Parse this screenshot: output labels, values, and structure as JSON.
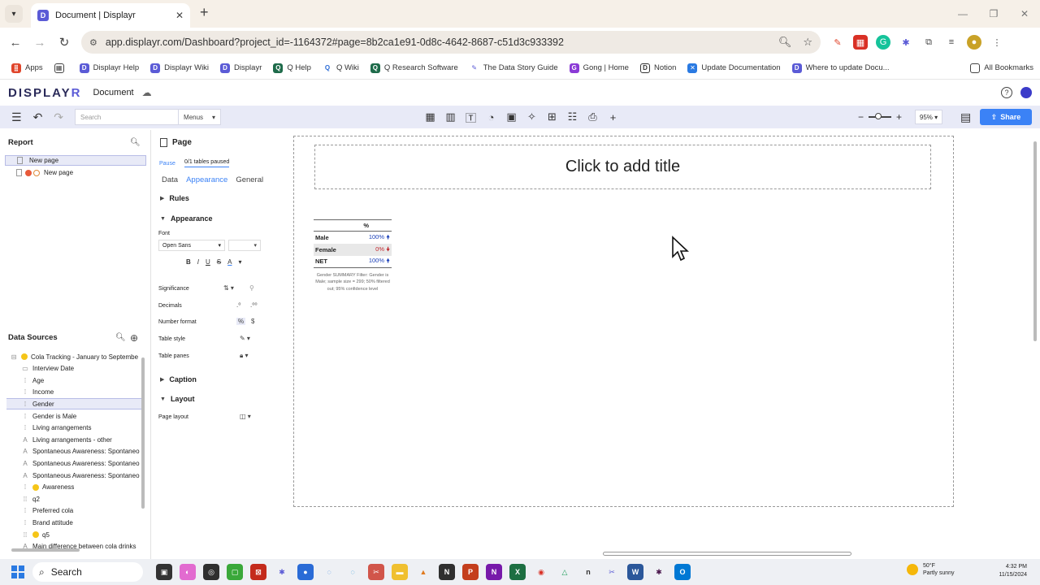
{
  "browser": {
    "tab_title": "Document | Displayr",
    "tab_favicon": "D",
    "url": "app.displayr.com/Dashboard?project_id=-1164372#page=8b2ca1e91-0d8c-4642-8687-c51d3c933392",
    "bookmarks": [
      "Apps",
      "Displayr Help",
      "Displayr Wiki",
      "Displayr",
      "Q Help",
      "Q Wiki",
      "Q Research Software",
      "The Data Story Guide",
      "Gong | Home",
      "Notion",
      "Update Documentation",
      "Where to update Docu..."
    ],
    "all_bookmarks": "All Bookmarks"
  },
  "app": {
    "logo_main": "DISPLAY",
    "logo_r": "R",
    "document_name": "Document",
    "search_placeholder": "Search",
    "menus_label": "Menus",
    "zoom": "95%",
    "share_label": "Share"
  },
  "report": {
    "heading": "Report",
    "pages": [
      "New page",
      "New page"
    ]
  },
  "data_sources": {
    "heading": "Data Sources",
    "items": [
      {
        "label": "Cola Tracking - January to Septembe",
        "icon": "dataset",
        "dot": true
      },
      {
        "label": "Interview Date",
        "icon": "date",
        "dot": false
      },
      {
        "label": "Age",
        "icon": "categorical",
        "dot": false
      },
      {
        "label": "Income",
        "icon": "categorical",
        "dot": false
      },
      {
        "label": "Gender",
        "icon": "categorical",
        "dot": false
      },
      {
        "label": "Gender is Male",
        "icon": "categorical",
        "dot": false
      },
      {
        "label": "Living arrangements",
        "icon": "categorical",
        "dot": false
      },
      {
        "label": "Living arrangements - other",
        "icon": "text",
        "dot": false
      },
      {
        "label": "Spontaneous Awareness: Spontaneo",
        "icon": "text",
        "dot": false
      },
      {
        "label": "Spontaneous Awareness: Spontaneo",
        "icon": "text",
        "dot": false
      },
      {
        "label": "Spontaneous Awareness: Spontaneo",
        "icon": "text",
        "dot": false
      },
      {
        "label": "Awareness",
        "icon": "categorical",
        "dot": true
      },
      {
        "label": "q2",
        "icon": "grid",
        "dot": false
      },
      {
        "label": "Preferred cola",
        "icon": "categorical",
        "dot": false
      },
      {
        "label": "Brand attitude",
        "icon": "categorical",
        "dot": false
      },
      {
        "label": "q5",
        "icon": "grid",
        "dot": true
      },
      {
        "label": "Main difference between cola drinks",
        "icon": "text",
        "dot": false
      }
    ]
  },
  "properties": {
    "title": "Page",
    "pause": "Pause",
    "paused_status": "0/1 tables paused",
    "tabs": [
      "Data",
      "Appearance",
      "General"
    ],
    "sections": {
      "rules": "Rules",
      "appearance": "Appearance",
      "caption": "Caption",
      "layout": "Layout"
    },
    "font_label": "Font",
    "font_value": "Open Sans",
    "rows": [
      "Significance",
      "Decimals",
      "Number format",
      "Table style",
      "Table panes"
    ],
    "page_layout": "Page layout"
  },
  "canvas": {
    "title_placeholder": "Click to add title",
    "table": {
      "header": "%",
      "rows": [
        {
          "label": "Male",
          "value": "100%",
          "arrow": "up"
        },
        {
          "label": "Female",
          "value": "0%",
          "arrow": "down"
        },
        {
          "label": "NET",
          "value": "100%",
          "arrow": "up"
        }
      ],
      "note": "Gender SUMMARY Filter: Gender is Male; sample size = 299; 50% filtered out; 95% confidence level"
    }
  },
  "taskbar": {
    "search": "Search",
    "weather_temp": "50°F",
    "weather_desc": "Partly sunny",
    "time": "4:32 PM",
    "date": "11/15/2024"
  },
  "colors": {
    "accent": "#3b82f6",
    "brand": "#5b5bd6",
    "selection": "#e8eaf7",
    "up_arrow": "#1a3fb8",
    "down_arrow": "#c0272d"
  }
}
